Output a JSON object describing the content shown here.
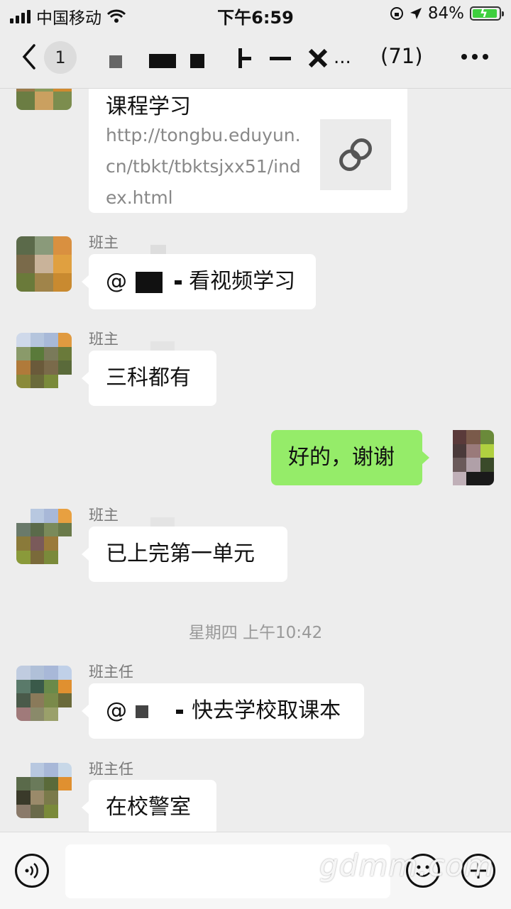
{
  "status_bar": {
    "carrier": "中国移动",
    "time": "下午6:59",
    "battery": "84%"
  },
  "nav": {
    "unread_count": "1",
    "member_count": "(71)",
    "title_suffix": "..."
  },
  "messages": {
    "link_card": {
      "title": "课程学习",
      "url": "http://tongbu.eduyun.cn/tbkt/tbktsjxx51/index.html"
    },
    "m1": {
      "sender": "班主",
      "mention": "@",
      "text": "看视频学习"
    },
    "m2": {
      "sender": "班主",
      "text": "三科都有"
    },
    "m3": {
      "text": "好的，谢谢"
    },
    "m4": {
      "sender": "班主",
      "text": "已上完第一单元"
    },
    "timestamp": "星期四 上午10:42",
    "m5": {
      "sender": "班主任",
      "mention": "@",
      "text": "快去学校取课本"
    },
    "m6": {
      "sender": "班主任",
      "text": "在校警室"
    }
  },
  "input_bar": {
    "placeholder": ""
  },
  "watermark": "gdmm.com",
  "colors": {
    "background": "#ededed",
    "my_bubble": "#95ec69",
    "their_bubble": "#ffffff"
  }
}
